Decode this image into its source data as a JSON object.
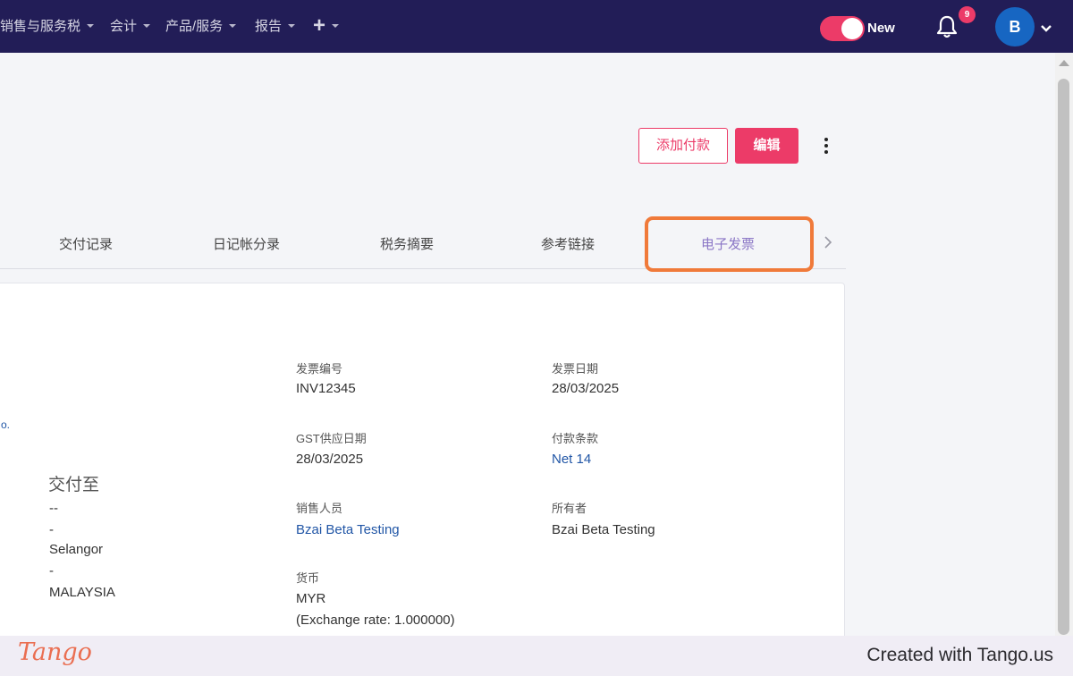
{
  "nav": {
    "items": [
      {
        "label": "销售与服务税"
      },
      {
        "label": "会计"
      },
      {
        "label": "产品/服务"
      },
      {
        "label": "报告"
      }
    ],
    "plus_label": "+",
    "toggle_label": "New",
    "notification_count": "9",
    "avatar_initial": "B"
  },
  "actions": {
    "add_payment": "添加付款",
    "edit": "编辑"
  },
  "tabs": [
    {
      "label": "交付记录"
    },
    {
      "label": "日记帐分录"
    },
    {
      "label": "税务摘要"
    },
    {
      "label": "参考链接"
    },
    {
      "label": "电子发票",
      "active": true
    }
  ],
  "invoice": {
    "invoice_no_label": "发票编号",
    "invoice_no": "INV12345",
    "invoice_date_label": "发票日期",
    "invoice_date": "28/03/2025",
    "gst_date_label": "GST供应日期",
    "gst_date": "28/03/2025",
    "terms_label": "付款条款",
    "terms": "Net 14",
    "salesperson_label": "销售人员",
    "salesperson": "Bzai Beta Testing",
    "owner_label": "所有者",
    "owner": "Bzai Beta Testing",
    "currency_label": "货币",
    "currency": "MYR",
    "exchange_rate": "(Exchange rate: 1.000000)"
  },
  "deliver_to": {
    "title": "交付至",
    "lines": [
      "--",
      "-",
      "Selangor",
      "-",
      "MALAYSIA"
    ],
    "edge_text": "o."
  },
  "footer": {
    "logo": "Tango",
    "created_with": "Created with Tango.us"
  },
  "colors": {
    "nav_bg": "#221d57",
    "accent": "#ec3b68",
    "link": "#2156a6",
    "highlight": "#f07a3a",
    "active_tab": "#8b77c6"
  }
}
